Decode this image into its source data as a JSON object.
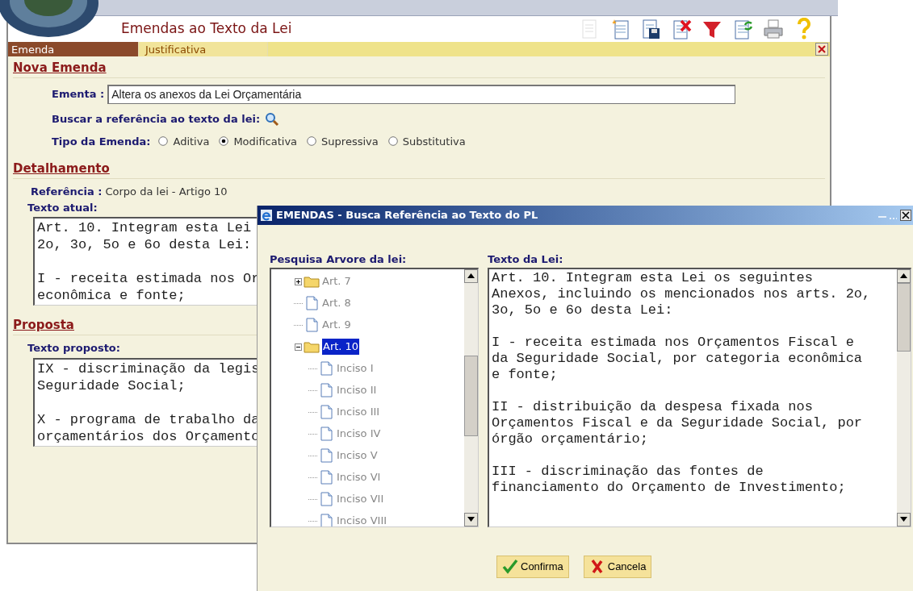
{
  "header": {
    "title": "Emendas ao Texto da Lei"
  },
  "toolbar": [
    {
      "kind": "document",
      "disabled": true
    },
    {
      "kind": "new",
      "disabled": false
    },
    {
      "kind": "save",
      "disabled": false
    },
    {
      "kind": "delete",
      "disabled": false
    },
    {
      "kind": "filter",
      "disabled": false
    },
    {
      "kind": "refresh",
      "disabled": false
    },
    {
      "kind": "print",
      "disabled": false
    },
    {
      "kind": "help",
      "disabled": false
    }
  ],
  "tabs": [
    {
      "label": "Emenda",
      "selected": true
    },
    {
      "label": "Justificativa",
      "selected": false
    }
  ],
  "nova_emenda": {
    "heading": "Nova Emenda",
    "ementa_label": "Ementa :",
    "ementa_value": "Altera os anexos da Lei Orçamentária",
    "buscar_label": "Buscar a referência ao texto da lei:",
    "tipo_label": "Tipo da Emenda:",
    "tipo_options": [
      {
        "label": "Aditiva",
        "selected": false
      },
      {
        "label": "Modificativa",
        "selected": true
      },
      {
        "label": "Supressiva",
        "selected": false
      },
      {
        "label": "Substitutiva",
        "selected": false
      }
    ]
  },
  "detalhamento": {
    "heading": "Detalhamento",
    "referencia_label": "Referência :",
    "referencia_value": "Corpo da lei - Artigo 10",
    "texto_atual_label": "Texto atual:",
    "texto_atual": [
      [
        "Art. 10. Integram esta Lei",
        "2o, 3o, 5o e 6o desta Lei:"
      ],
      [
        "I - receita estimada nos Or",
        "econômica e fonte;"
      ]
    ]
  },
  "proposta": {
    "heading": "Proposta",
    "texto_proposto_label": "Texto proposto:",
    "texto_proposto": [
      [
        "IX - discriminação da legis",
        "Seguridade Social;"
      ],
      [
        "X - programa de trabalho da",
        "orçamentários dos Orçamento"
      ]
    ]
  },
  "dialog": {
    "title": "EMENDAS - Busca Referência ao Texto do PL",
    "tree_label": "Pesquisa Arvore da lei:",
    "tree": [
      {
        "label": "Art. 7",
        "kind": "folder",
        "expanded": false,
        "selected": false
      },
      {
        "label": "Art. 8",
        "kind": "document",
        "selected": false
      },
      {
        "label": "Art. 9",
        "kind": "document",
        "selected": false
      },
      {
        "label": "Art. 10",
        "kind": "folder",
        "expanded": true,
        "selected": true,
        "children": [
          {
            "label": "Inciso I",
            "kind": "document",
            "selected": false
          },
          {
            "label": "Inciso II",
            "kind": "document",
            "selected": false
          },
          {
            "label": "Inciso III",
            "kind": "document",
            "selected": false
          },
          {
            "label": "Inciso IV",
            "kind": "document",
            "selected": false
          },
          {
            "label": "Inciso V",
            "kind": "document",
            "selected": false
          },
          {
            "label": "Inciso VI",
            "kind": "document",
            "selected": false
          },
          {
            "label": "Inciso VII",
            "kind": "document",
            "selected": false
          },
          {
            "label": "Inciso VIII",
            "kind": "document",
            "selected": false
          }
        ]
      }
    ],
    "text_label": "Texto da Lei:",
    "text": [
      [
        "Art. 10. Integram esta Lei os seguintes",
        "Anexos, incluindo os mencionados nos arts. 2o,",
        "3o, 5o e 6o desta Lei:"
      ],
      [
        "I - receita estimada nos Orçamentos Fiscal e",
        "da Seguridade Social, por categoria econômica",
        "e fonte;"
      ],
      [
        "II - distribuição da despesa fixada nos",
        "Orçamentos Fiscal e da Seguridade Social, por",
        "órgão orçamentário;"
      ],
      [
        "III - discriminação das fontes de",
        "financiamento do Orçamento de Investimento;"
      ]
    ],
    "buttons": [
      {
        "label": "Confirma",
        "kind": "confirm"
      },
      {
        "label": "Cancela",
        "kind": "cancel"
      }
    ]
  }
}
